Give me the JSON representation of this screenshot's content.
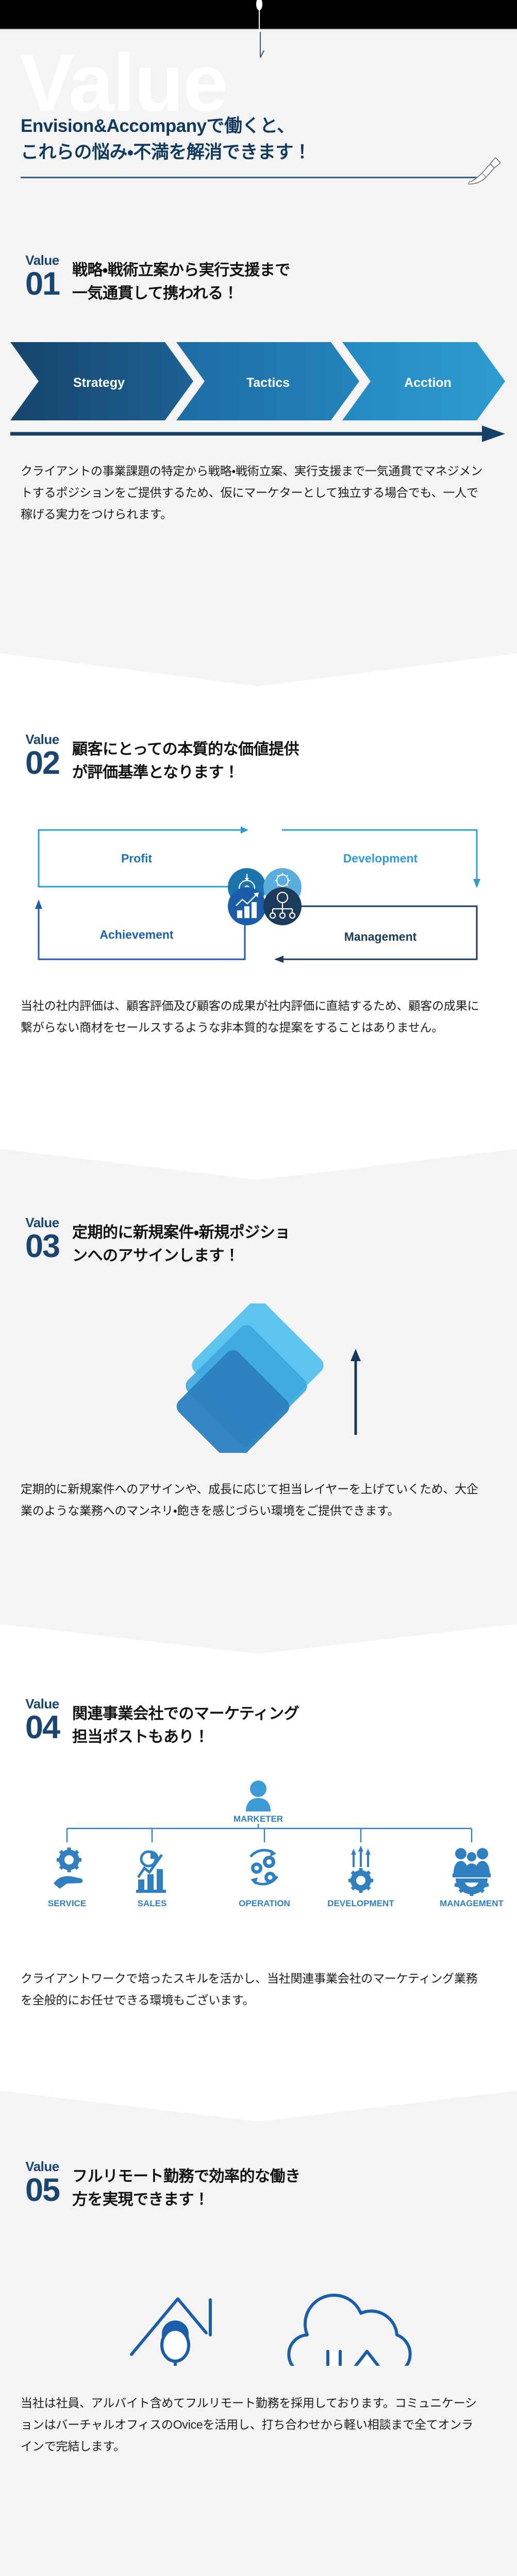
{
  "hero": {
    "watermark": "Value",
    "title_line1": "Envision&Accompanyで働くと、",
    "title_line2": "これらの悩み・不満を解消できます！",
    "pen_icon": "pen-writing-icon"
  },
  "colors": {
    "navy": "#1a4570",
    "deep_navy": "#11395e",
    "steel": "#1a4f7a",
    "mid_blue": "#1c6da8",
    "bright_blue": "#2b95c9",
    "sky_blue": "#5cc4ef",
    "royal_blue": "#1a5eab",
    "panel_grey": "#f4f4f5",
    "white": "#ffffff",
    "black": "#000000",
    "text": "#1c1c1c"
  },
  "values": [
    {
      "label": "Value",
      "number": "01",
      "title_line1": "戦略・戦術立案から実行支援まで",
      "title_line2": "一気通貫して携われる！",
      "body": "クライアントの事業課題の特定から戦略・戦術立案、実行支援まで一気通貫でマネジメントするポジションをご提供するため、仮にマーケターとして独立する場合でも、一人で稼げる実力をつけられます。",
      "diagram": {
        "type": "chevron-flow",
        "steps": [
          {
            "label": "Strategy",
            "color": "#1a4f7a"
          },
          {
            "label": "Tactics",
            "color": "#1f7fb5"
          },
          {
            "label": "Acction",
            "color": "#2b95c9"
          }
        ],
        "arrow_icon": "right-arrow-icon"
      }
    },
    {
      "label": "Value",
      "number": "02",
      "title_line1": "顧客にとっての本質的な価値提供",
      "title_line2": "が評価基準となります！",
      "body": "当社の社内評価は、顧客評価及び顧客の成果が社内評価に直結するため、顧客の成果に繋がらない商材をセールスするような非本質的な提案をすることはありません。",
      "diagram": {
        "type": "cycle",
        "nodes": [
          {
            "label": "Profit",
            "icon": "money-target-icon",
            "color": "#1c74ad",
            "text_color": "#1c74ad"
          },
          {
            "label": "Development",
            "icon": "gear-box-icon",
            "color": "#5aaede",
            "text_color": "#2f9bd6"
          },
          {
            "label": "Achievement",
            "icon": "bar-chart-up-icon",
            "color": "#1a5eab",
            "text_color": "#1a5eab"
          },
          {
            "label": "Management",
            "icon": "org-chart-icon",
            "color": "#1b3a5c",
            "text_color": "#1b3a5c"
          }
        ]
      }
    },
    {
      "label": "Value",
      "number": "03",
      "title_line1": "定期的に新規案件・新規ポジショ",
      "title_line2": "ンへのアサインします！",
      "body": "定期的に新規案件へのアサインや、成長に応じて担当レイヤーを上げていくため、大企業のような業務へのマンネリ・飽きを感じづらい環境をご提供できます。",
      "diagram": {
        "type": "stacked-layers",
        "layer_colors": [
          "#5cc4ef",
          "#3ea8de",
          "#2b7fc0"
        ],
        "arrow_icon": "up-arrow-icon"
      }
    },
    {
      "label": "Value",
      "number": "04",
      "title_line1": "関連事業会社でのマーケティング",
      "title_line2": "担当ポストもあり！",
      "body": "クライアントワークで培ったスキルを活かし、当社関連事業会社のマーケティング業務を全般的にお任せできる環境もございます。",
      "diagram": {
        "type": "org-chart",
        "root": {
          "label": "MARKETER",
          "icon": "person-icon"
        },
        "children": [
          {
            "label": "SERVICE",
            "icon": "gear-hand-icon"
          },
          {
            "label": "SALES",
            "icon": "chart-growth-icon"
          },
          {
            "label": "OPERATION",
            "icon": "gears-cycle-icon"
          },
          {
            "label": "DEVELOPMENT",
            "icon": "gear-arrows-up-icon"
          },
          {
            "label": "MANAGEMENT",
            "icon": "people-gear-icon"
          }
        ],
        "accent": "#2f7fc1"
      }
    },
    {
      "label": "Value",
      "number": "05",
      "title_line1": "フルリモート勤務で効率的な働き",
      "title_line2": "方を実現できます！",
      "body": "当社は社員、アルバイト含めてフルリモート勤務を採用しております。コミュニケーションはバーチャルオフィスのOviceを活用し、打ち合わせから軽い相談まで全てオンラインで完結します。",
      "diagram": {
        "type": "remote-icons",
        "icons": [
          {
            "name": "home-worker-laptop-icon"
          },
          {
            "name": "cloud-sync-icon"
          }
        ],
        "accent": "#1a5eab"
      }
    }
  ]
}
